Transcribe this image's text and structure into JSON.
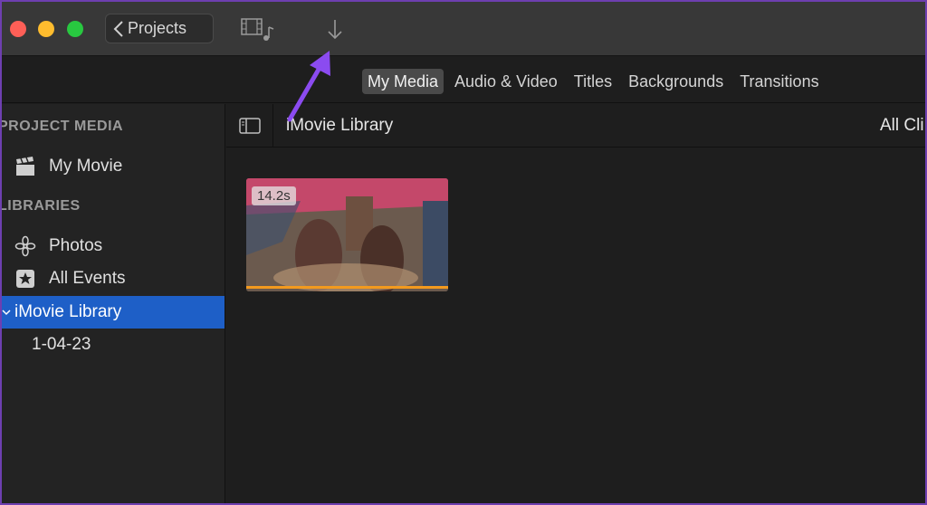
{
  "titlebar": {
    "back_label": "Projects",
    "icons": [
      "close-dot",
      "minimize-dot",
      "zoom-dot",
      "film-music-icon",
      "import-arrow-icon"
    ]
  },
  "browser_tabs": [
    {
      "label": "My Media",
      "active": true
    },
    {
      "label": "Audio & Video",
      "active": false
    },
    {
      "label": "Titles",
      "active": false
    },
    {
      "label": "Backgrounds",
      "active": false
    },
    {
      "label": "Transitions",
      "active": false
    }
  ],
  "sidebar": {
    "project_media_title": "PROJECT MEDIA",
    "my_movie": "My Movie",
    "libraries_title": "LIBRARIES",
    "photos": "Photos",
    "all_events": "All Events",
    "imovie_library": "iMovie Library",
    "event_date": "1-04-23"
  },
  "content": {
    "library_title": "iMovie Library",
    "filter_label": "All Cli",
    "clips": [
      {
        "duration": "14.2s"
      }
    ]
  },
  "colors": {
    "accent_selection": "#1e5fc7",
    "annotation_arrow": "#8b4bf0",
    "clip_progress": "#f39a1e"
  }
}
